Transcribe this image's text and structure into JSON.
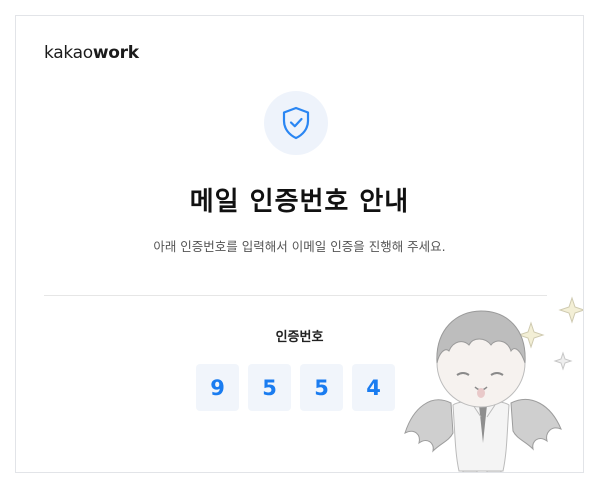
{
  "brand": {
    "logo_light": "kakao",
    "logo_bold": "work"
  },
  "header": {
    "title": "메일 인증번호 안내"
  },
  "body": {
    "description": "아래 인증번호를 입력해서 이메일 인증을 진행해 주세요."
  },
  "verification": {
    "label": "인증번호",
    "digits": [
      "9",
      "5",
      "5",
      "4"
    ]
  },
  "colors": {
    "accent": "#1a7cf0",
    "digit_bg": "#f1f5fb",
    "icon_bg": "#eef3fb",
    "border": "#e2e4e8"
  },
  "icons": {
    "shield": "shield-check-icon"
  }
}
